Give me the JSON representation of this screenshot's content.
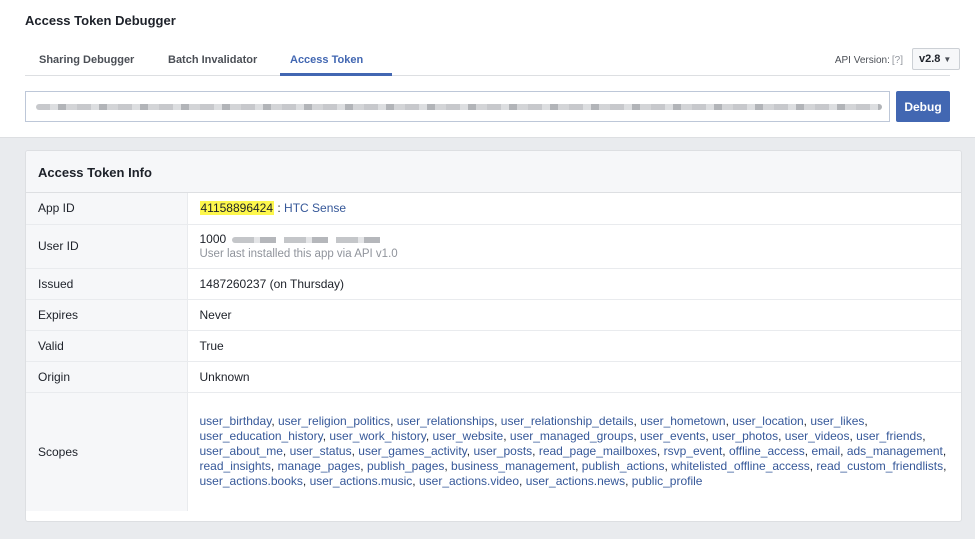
{
  "header": {
    "title": "Access Token Debugger"
  },
  "tabs": [
    {
      "label": "Sharing Debugger"
    },
    {
      "label": "Batch Invalidator"
    },
    {
      "label": "Access Token"
    }
  ],
  "api_version": {
    "label": "API Version:",
    "help": "[?]",
    "value": "v2.8"
  },
  "token_input": {
    "value": ""
  },
  "debug_button": {
    "label": "Debug"
  },
  "info": {
    "title": "Access Token Info",
    "rows": {
      "app_id": {
        "key": "App ID",
        "id": "41158896424",
        "separator": " : ",
        "app_name": "HTC Sense"
      },
      "user_id": {
        "key": "User ID",
        "value": "1000",
        "note": "User last installed this app via API v1.0"
      },
      "issued": {
        "key": "Issued",
        "value": "1487260237 (on Thursday)"
      },
      "expires": {
        "key": "Expires",
        "value": "Never"
      },
      "valid": {
        "key": "Valid",
        "value": "True"
      },
      "origin": {
        "key": "Origin",
        "value": "Unknown"
      },
      "scopes": {
        "key": "Scopes",
        "values": [
          "user_birthday",
          "user_religion_politics",
          "user_relationships",
          "user_relationship_details",
          "user_hometown",
          "user_location",
          "user_likes",
          "user_education_history",
          "user_work_history",
          "user_website",
          "user_managed_groups",
          "user_events",
          "user_photos",
          "user_videos",
          "user_friends",
          "user_about_me",
          "user_status",
          "user_games_activity",
          "user_posts",
          "read_page_mailboxes",
          "rsvp_event",
          "offline_access",
          "email",
          "ads_management",
          "read_insights",
          "manage_pages",
          "publish_pages",
          "business_management",
          "publish_actions",
          "whitelisted_offline_access",
          "read_custom_friendlists",
          "user_actions.books",
          "user_actions.music",
          "user_actions.video",
          "user_actions.news",
          "public_profile"
        ]
      }
    }
  }
}
